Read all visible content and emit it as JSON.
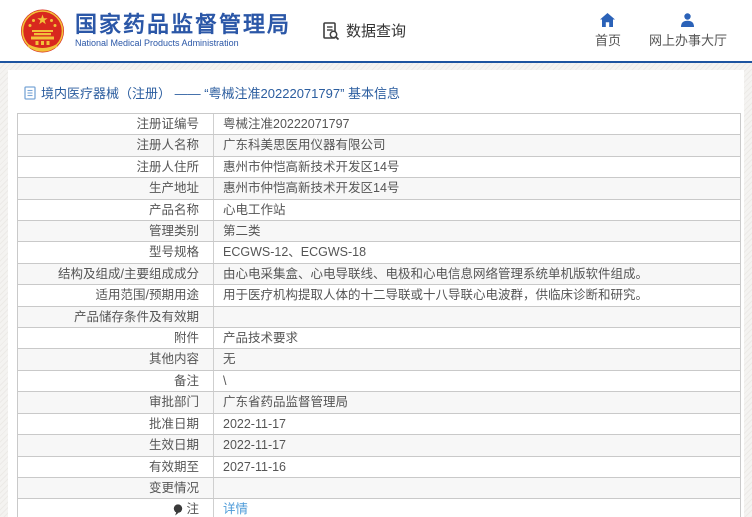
{
  "header": {
    "brand": {
      "title_cn": "国家药品监督管理局",
      "title_en": "National Medical Products Administration"
    },
    "data_query_label": "数据查询",
    "nav": [
      {
        "label": "首页",
        "icon": "home-icon"
      },
      {
        "label": "网上办事大厅",
        "icon": "person-icon"
      }
    ]
  },
  "breadcrumb": {
    "title": "境内医疗器械（注册） —— “粤械注准20222071797” 基本信息"
  },
  "table": {
    "rows": [
      {
        "label": "注册证编号",
        "value": "粤械注准20222071797"
      },
      {
        "label": "注册人名称",
        "value": "广东科美思医用仪器有限公司"
      },
      {
        "label": "注册人住所",
        "value": "惠州市仲恺高新技术开发区14号"
      },
      {
        "label": "生产地址",
        "value": "惠州市仲恺高新技术开发区14号"
      },
      {
        "label": "产品名称",
        "value": "心电工作站"
      },
      {
        "label": "管理类别",
        "value": "第二类"
      },
      {
        "label": "型号规格",
        "value": "ECGWS-12、ECGWS-18"
      },
      {
        "label": "结构及组成/主要组成成分",
        "value": "由心电采集盒、心电导联线、电极和心电信息网络管理系统单机版软件组成。"
      },
      {
        "label": "适用范围/预期用途",
        "value": "用于医疗机构提取人体的十二导联或十八导联心电波群，供临床诊断和研究。"
      },
      {
        "label": "产品储存条件及有效期",
        "value": ""
      },
      {
        "label": "附件",
        "value": "产品技术要求"
      },
      {
        "label": "其他内容",
        "value": "无"
      },
      {
        "label": "备注",
        "value": "\\"
      },
      {
        "label": "审批部门",
        "value": "广东省药品监督管理局"
      },
      {
        "label": "批准日期",
        "value": "2022-11-17"
      },
      {
        "label": "生效日期",
        "value": "2022-11-17"
      },
      {
        "label": "有效期至",
        "value": "2027-11-16"
      },
      {
        "label": "变更情况",
        "value": ""
      },
      {
        "label": "注",
        "value_link": "详情"
      }
    ]
  },
  "colors": {
    "accent_blue": "#2b57a7",
    "header_border_blue": "#1d54a0",
    "link_blue": "#4c9ad8",
    "emblem_red": "#d8281e",
    "emblem_gold": "#f2c139"
  }
}
